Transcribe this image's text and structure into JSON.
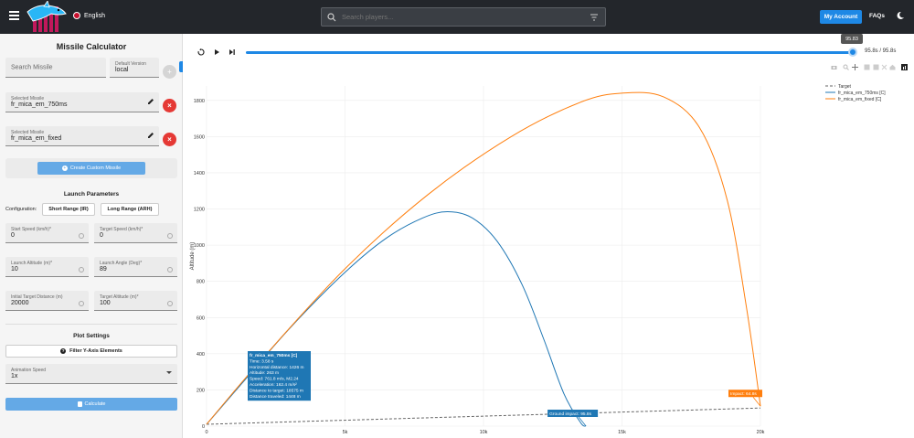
{
  "header": {
    "language": "English",
    "search_placeholder": "Search players...",
    "account_label": "My Account",
    "faqs_label": "FAQs"
  },
  "sidebar": {
    "title": "Missile Calculator",
    "search_missile_placeholder": "Search Missile",
    "version_label": "Default Version",
    "version_value": "local",
    "selected1_label": "Selected Missile",
    "selected1_value": "fr_mica_em_750ms",
    "selected2_label": "Selected Missile",
    "selected2_value": "fr_mica_em_fixed",
    "create_custom_label": "Create Custom Missile",
    "launch_params_title": "Launch Parameters",
    "configuration_label": "Configuration:",
    "config_short": "Short Range (IR)",
    "config_long": "Long Range (ARH)",
    "start_speed_label": "Start Speed (km/h)*",
    "start_speed_value": "0",
    "target_speed_label": "Target Speed (km/h)*",
    "target_speed_value": "0",
    "launch_alt_label": "Launch Altitude (m)*",
    "launch_alt_value": "10",
    "launch_angle_label": "Launch Angle (Deg)*",
    "launch_angle_value": "89",
    "init_dist_label": "Initial Target Distance (m)",
    "init_dist_value": "20000",
    "target_alt_label": "Target Altitude (m)*",
    "target_alt_value": "100",
    "plot_settings_title": "Plot Settings",
    "filter_label": "Filter Y-Axis Elements",
    "anim_speed_label": "Animation Speed",
    "anim_speed_value": "1x",
    "calculate_label": "Calculate"
  },
  "player": {
    "slider_value": "95.83",
    "time_readout": "95.8s / 95.8s",
    "slider_fraction": 1.0
  },
  "chart_data": {
    "type": "line",
    "ylabel": "Altitude (m)",
    "xlabel": "",
    "xlim": [
      0,
      20000
    ],
    "ylim": [
      0,
      1880
    ],
    "x_ticks": [
      "0",
      "5k",
      "10k",
      "15k",
      "20k"
    ],
    "x_tick_values": [
      0,
      5000,
      10000,
      15000,
      20000
    ],
    "y_ticks": [
      "0",
      "200",
      "400",
      "600",
      "800",
      "1000",
      "1200",
      "1400",
      "1600",
      "1800"
    ],
    "y_tick_values": [
      0,
      200,
      400,
      600,
      800,
      1000,
      1200,
      1400,
      1600,
      1800
    ],
    "grid": true,
    "legend_position": "top-right",
    "series": [
      {
        "name": "Target",
        "color": "#666666",
        "dash": true,
        "x": [
          0,
          20000
        ],
        "y": [
          10,
          100
        ]
      },
      {
        "name": "fr_mica_em_750ms [C]",
        "color": "#1f77b4",
        "x": [
          0,
          1426,
          3000,
          5000,
          6500,
          7800,
          8700,
          9600,
          10500,
          11400,
          12200,
          12900,
          13500,
          13700
        ],
        "y": [
          10,
          263,
          540,
          850,
          1040,
          1150,
          1185,
          1150,
          1020,
          780,
          470,
          180,
          20,
          0
        ]
      },
      {
        "name": "fr_mica_em_fixed [C]",
        "color": "#ff7f0e",
        "x": [
          0,
          2000,
          5000,
          8000,
          11000,
          13500,
          15000,
          16500,
          17800,
          18800,
          19500,
          20000
        ],
        "y": [
          10,
          370,
          870,
          1280,
          1600,
          1790,
          1840,
          1820,
          1650,
          1250,
          650,
          110
        ]
      }
    ],
    "annotations": [
      {
        "lines": [
          "fr_mica_em_750ms [C]",
          "Time: 3.58 s",
          "Horizontal distance: 1426 m",
          "Altitude: 263 m",
          "Speed: 761.8 m/s, M2.24",
          "Acceleration: 162.4 m/s²",
          "Distance to target: 18575 m",
          "Distance traveled: 1448 m"
        ],
        "color": "#1f77b4",
        "at_x": 1426,
        "at_y": 263
      },
      {
        "text": "Ground impact: 95.8s",
        "color": "#1f77b4",
        "at_x": 13700,
        "at_y": 0
      },
      {
        "text": "Impact: 64.8s",
        "color": "#ff7f0e",
        "at_x": 20000,
        "at_y": 110
      }
    ]
  }
}
